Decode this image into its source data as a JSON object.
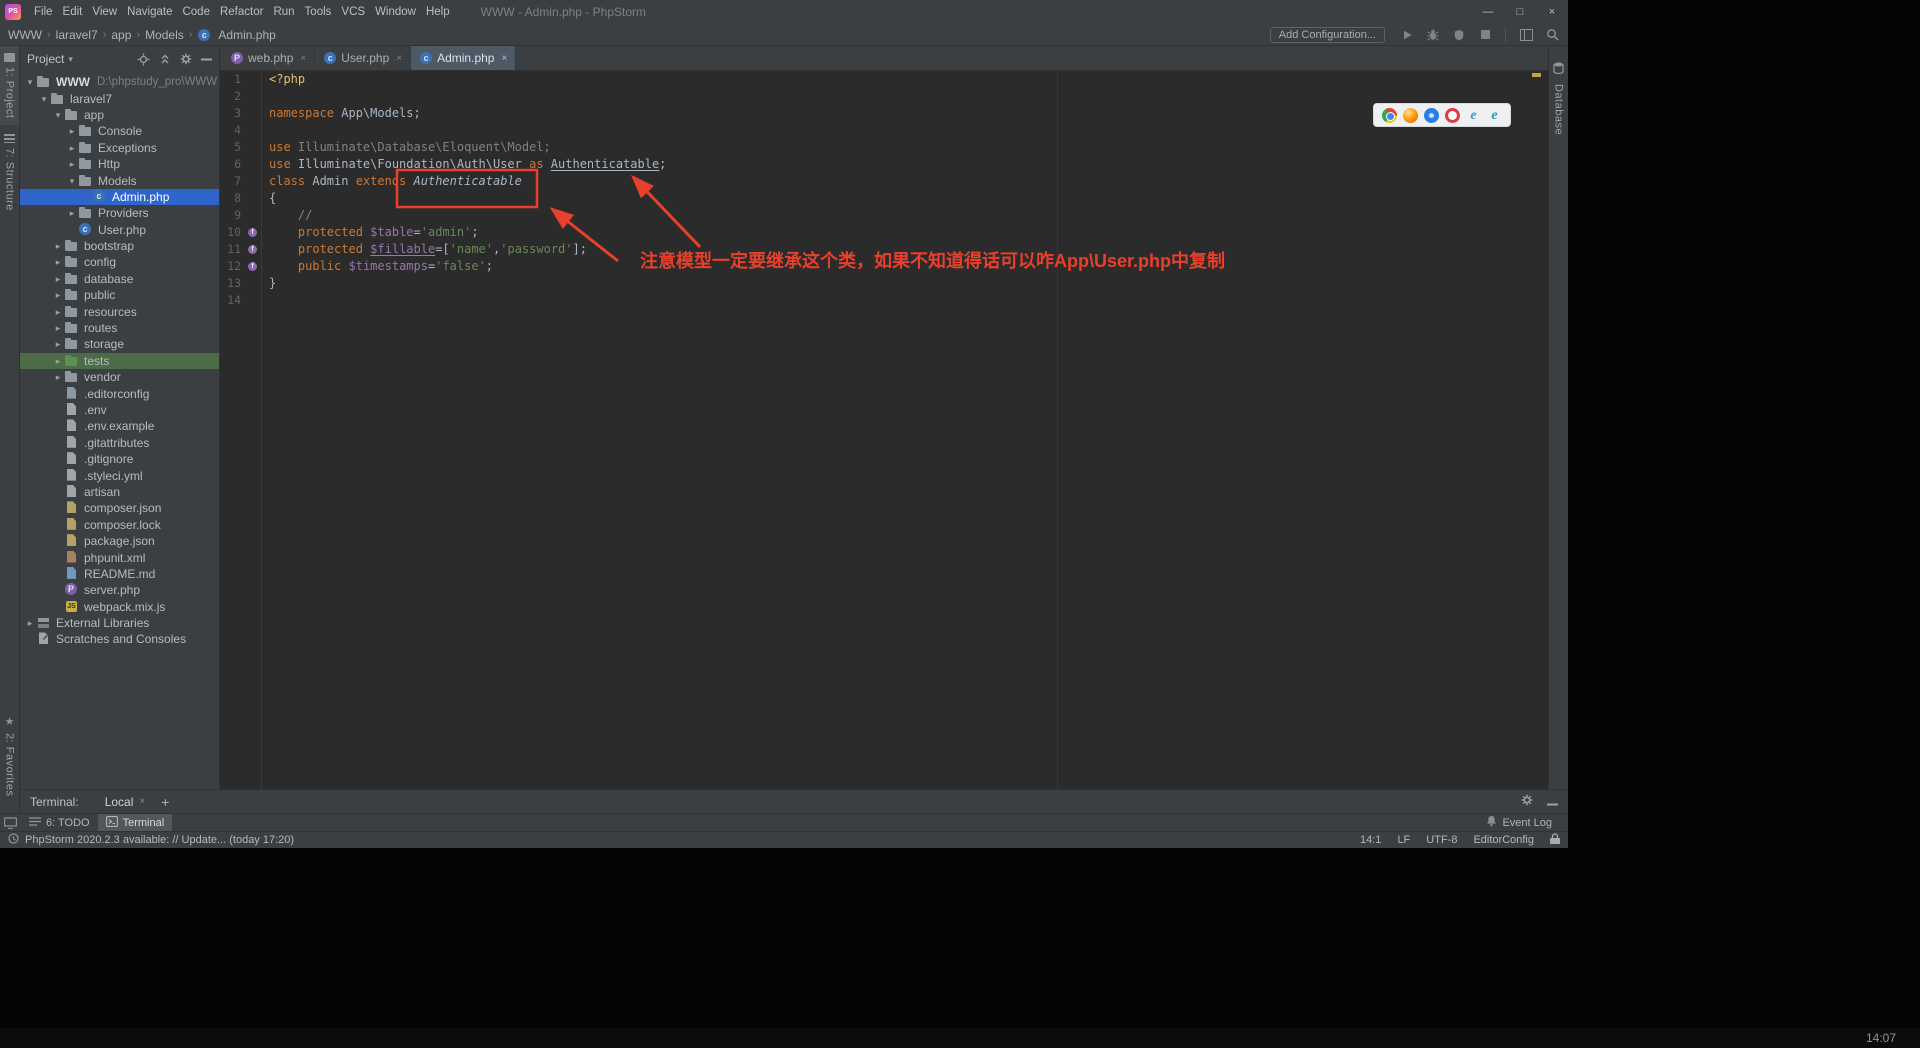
{
  "colors": {
    "editor_bg": "#2b2b2b",
    "panel_bg": "#3c3f41",
    "selection_blue": "#2f65ca",
    "test_folder_green": "#4c6b47",
    "annotation_red": "#e8402c",
    "keyword_orange": "#cc7832",
    "string_green": "#6a8759",
    "variable_purple": "#9876aa"
  },
  "titlebar": {
    "logo": "PS",
    "title": "WWW - Admin.php - PhpStorm",
    "menus": [
      "File",
      "Edit",
      "View",
      "Navigate",
      "Code",
      "Refactor",
      "Run",
      "Tools",
      "VCS",
      "Window",
      "Help"
    ]
  },
  "navbar": {
    "breadcrumbs": [
      "WWW",
      "laravel7",
      "app",
      "Models",
      "Admin.php"
    ],
    "add_config": "Add Configuration..."
  },
  "stripes": {
    "project": "1: Project",
    "structure": "7: Structure",
    "favorites": "2: Favorites",
    "database": "Database"
  },
  "project_panel": {
    "title": "Project"
  },
  "tree": [
    {
      "l": 0,
      "c": "d",
      "i": "folder",
      "t": "WWW",
      "x": "D:\\phpstudy_pro\\WWW",
      "bold": true
    },
    {
      "l": 1,
      "c": "d",
      "i": "folder",
      "t": "laravel7"
    },
    {
      "l": 2,
      "c": "d",
      "i": "folder",
      "t": "app"
    },
    {
      "l": 3,
      "c": "r",
      "i": "folder",
      "t": "Console"
    },
    {
      "l": 3,
      "c": "r",
      "i": "folder",
      "t": "Exceptions"
    },
    {
      "l": 3,
      "c": "r",
      "i": "folder",
      "t": "Http"
    },
    {
      "l": 3,
      "c": "d",
      "i": "folder",
      "t": "Models"
    },
    {
      "l": 4,
      "c": "",
      "i": "phpclass",
      "t": "Admin.php",
      "sel": true
    },
    {
      "l": 3,
      "c": "r",
      "i": "folder",
      "t": "Providers"
    },
    {
      "l": 3,
      "c": "",
      "i": "phpclass",
      "t": "User.php"
    },
    {
      "l": 2,
      "c": "r",
      "i": "folder",
      "t": "bootstrap"
    },
    {
      "l": 2,
      "c": "r",
      "i": "folder",
      "t": "config"
    },
    {
      "l": 2,
      "c": "r",
      "i": "folder",
      "t": "database"
    },
    {
      "l": 2,
      "c": "r",
      "i": "folder",
      "t": "public"
    },
    {
      "l": 2,
      "c": "r",
      "i": "folder",
      "t": "resources"
    },
    {
      "l": 2,
      "c": "r",
      "i": "folder",
      "t": "routes"
    },
    {
      "l": 2,
      "c": "r",
      "i": "folder",
      "t": "storage"
    },
    {
      "l": 2,
      "c": "r",
      "i": "folder-test",
      "t": "tests",
      "hl": true
    },
    {
      "l": 2,
      "c": "r",
      "i": "folder",
      "t": "vendor"
    },
    {
      "l": 2,
      "c": "",
      "i": "config-file",
      "t": ".editorconfig"
    },
    {
      "l": 2,
      "c": "",
      "i": "file",
      "t": ".env"
    },
    {
      "l": 2,
      "c": "",
      "i": "file",
      "t": ".env.example"
    },
    {
      "l": 2,
      "c": "",
      "i": "file",
      "t": ".gitattributes"
    },
    {
      "l": 2,
      "c": "",
      "i": "file",
      "t": ".gitignore"
    },
    {
      "l": 2,
      "c": "",
      "i": "yml-file",
      "t": ".styleci.yml"
    },
    {
      "l": 2,
      "c": "",
      "i": "file",
      "t": "artisan"
    },
    {
      "l": 2,
      "c": "",
      "i": "json-file",
      "t": "composer.json"
    },
    {
      "l": 2,
      "c": "",
      "i": "json-file",
      "t": "composer.lock"
    },
    {
      "l": 2,
      "c": "",
      "i": "json-file",
      "t": "package.json"
    },
    {
      "l": 2,
      "c": "",
      "i": "xml-file",
      "t": "phpunit.xml"
    },
    {
      "l": 2,
      "c": "",
      "i": "md-file",
      "t": "README.md"
    },
    {
      "l": 2,
      "c": "",
      "i": "phpfile",
      "t": "server.php"
    },
    {
      "l": 2,
      "c": "",
      "i": "js-file",
      "t": "webpack.mix.js"
    },
    {
      "l": 0,
      "c": "r",
      "i": "library",
      "t": "External Libraries"
    },
    {
      "l": 0,
      "c": "",
      "i": "scratch",
      "t": "Scratches and Consoles"
    }
  ],
  "tabs": [
    {
      "icon": "phpfile",
      "label": "web.php"
    },
    {
      "icon": "phpclass",
      "label": "User.php"
    },
    {
      "icon": "phpclass",
      "label": "Admin.php",
      "active": true
    }
  ],
  "editor": {
    "field_icon_lines": [
      10,
      11,
      12
    ],
    "lines": [
      [
        [
          "<?php",
          "tag"
        ]
      ],
      [],
      [
        [
          "namespace",
          "kw"
        ],
        [
          " App\\Models;",
          "txt"
        ]
      ],
      [],
      [
        [
          "use",
          "kw"
        ],
        [
          " Illuminate\\Database\\Eloquent\\Model;",
          "dim"
        ]
      ],
      [
        [
          "use",
          "kw"
        ],
        [
          " Illuminate\\Foundation\\Auth\\User ",
          "txt"
        ],
        [
          "as",
          "kw"
        ],
        [
          " ",
          "txt"
        ],
        [
          "Authenticatable",
          "txt und"
        ],
        [
          ";",
          "txt"
        ]
      ],
      [
        [
          "class",
          "kw"
        ],
        [
          " Admin ",
          "txt"
        ],
        [
          "extends",
          "kw"
        ],
        [
          " ",
          "txt"
        ],
        [
          "Authenticatable",
          "txt ita"
        ]
      ],
      [
        [
          "{",
          "txt"
        ]
      ],
      [
        [
          "    //",
          "cmt"
        ]
      ],
      [
        [
          "    ",
          "txt"
        ],
        [
          "protected",
          "kw"
        ],
        [
          " ",
          "txt"
        ],
        [
          "$table",
          "var"
        ],
        [
          "=",
          "txt"
        ],
        [
          "'admin'",
          "str"
        ],
        [
          ";",
          "txt"
        ]
      ],
      [
        [
          "    ",
          "txt"
        ],
        [
          "protected",
          "kw"
        ],
        [
          " ",
          "txt"
        ],
        [
          "$fillable",
          "var und"
        ],
        [
          "=[",
          "txt"
        ],
        [
          "'name'",
          "str"
        ],
        [
          ",",
          "txt"
        ],
        [
          "'password'",
          "str"
        ],
        [
          "];",
          "txt"
        ]
      ],
      [
        [
          "    ",
          "txt"
        ],
        [
          "public",
          "kw"
        ],
        [
          " ",
          "txt"
        ],
        [
          "$timestamps",
          "var"
        ],
        [
          "=",
          "txt"
        ],
        [
          "'false'",
          "str"
        ],
        [
          ";",
          "txt"
        ]
      ],
      [
        [
          "}",
          "txt"
        ]
      ],
      []
    ]
  },
  "browser_icons": [
    "chrome",
    "firefox",
    "safari",
    "opera",
    "ie",
    "edge"
  ],
  "annotation": {
    "text": "注意模型一定要继承这个类，如果不知道得话可以咋App\\User.php中复制"
  },
  "terminal": {
    "label": "Terminal:",
    "tab": "Local"
  },
  "bottom_bar": {
    "todo": "6: TODO",
    "terminal": "Terminal",
    "event_log": "Event Log"
  },
  "statusbar": {
    "message": "PhpStorm 2020.2.3 available: // Update... (today 17:20)",
    "caret": "14:1",
    "line_ending": "LF",
    "encoding": "UTF-8",
    "editorconfig": "EditorConfig"
  },
  "taskbar": {
    "clock": "14:07"
  }
}
